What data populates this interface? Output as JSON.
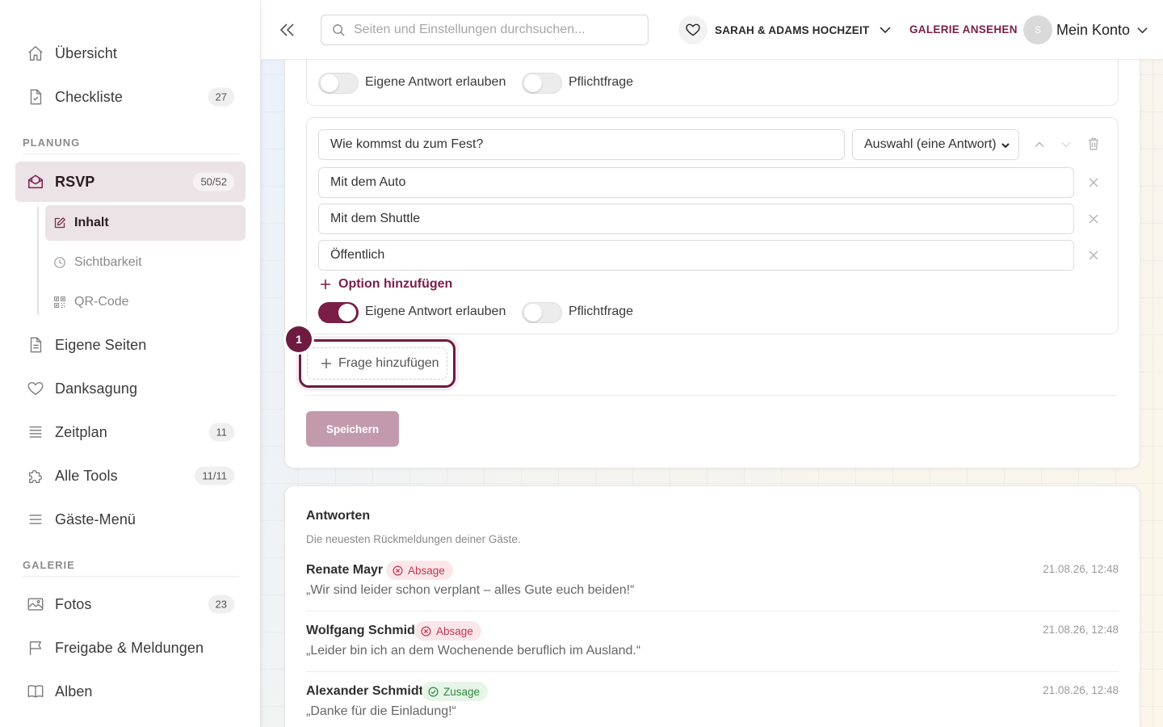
{
  "sidebar": {
    "items_top": [
      {
        "label": "Übersicht",
        "icon": "home-icon"
      },
      {
        "label": "Checkliste",
        "icon": "checklist-icon",
        "badge": "27"
      }
    ],
    "section_planning": "PLANUNG",
    "rsvp": {
      "label": "RSVP",
      "badge": "50/52",
      "icon": "envelope-icon"
    },
    "rsvp_sub": [
      {
        "label": "Inhalt",
        "icon": "edit-icon"
      },
      {
        "label": "Sichtbarkeit",
        "icon": "clock-icon"
      },
      {
        "label": "QR-Code",
        "icon": "qr-code-icon"
      }
    ],
    "items_planning": [
      {
        "label": "Eigene Seiten",
        "icon": "page-icon"
      },
      {
        "label": "Danksagung",
        "icon": "heart-icon"
      },
      {
        "label": "Zeitplan",
        "icon": "list-icon",
        "badge": "11"
      },
      {
        "label": "Alle Tools",
        "icon": "puzzle-icon",
        "badge": "11/11"
      },
      {
        "label": "Gäste-Menü",
        "icon": "menu-icon"
      }
    ],
    "section_gallery": "GALERIE",
    "items_gallery": [
      {
        "label": "Fotos",
        "icon": "image-icon",
        "badge": "23"
      },
      {
        "label": "Freigabe & Meldungen",
        "icon": "flag-icon"
      },
      {
        "label": "Alben",
        "icon": "book-icon"
      }
    ]
  },
  "topbar": {
    "search_placeholder": "Seiten und Einstellungen durchsuchen...",
    "event_name": "SARAH & ADAMS HOCHZEIT",
    "gallery_link": "GALERIE ANSEHEN",
    "account_initial": "S",
    "account_label": "Mein Konto"
  },
  "editor": {
    "prev_question_toggles": {
      "own_answer_label": "Eigene Antwort erlauben",
      "own_answer_on": false,
      "required_label": "Pflichtfrage",
      "required_on": false
    },
    "question": {
      "text": "Wie kommst du zum Fest?",
      "type": "Auswahl (eine Antwort)",
      "options": [
        "Mit dem Auto",
        "Mit dem Shuttle",
        "Öffentlich"
      ],
      "add_option_label": "Option hinzufügen",
      "own_answer_label": "Eigene Antwort erlauben",
      "own_answer_on": true,
      "required_label": "Pflichtfrage",
      "required_on": false
    },
    "add_question_label": "Frage hinzufügen",
    "step_number": "1",
    "save_label": "Speichern",
    "accent_color": "#7a1e48"
  },
  "responses": {
    "title": "Antworten",
    "subtitle": "Die neuesten Rückmeldungen deiner Gäste.",
    "items": [
      {
        "name": "Renate Mayr",
        "status": "Absage",
        "status_type": "negative",
        "time": "21.08.26, 12:48",
        "message": "„Wir sind leider schon verplant – alles Gute euch beiden!“"
      },
      {
        "name": "Wolfgang Schmid",
        "status": "Absage",
        "status_type": "negative",
        "time": "21.08.26, 12:48",
        "message": "„Leider bin ich an dem Wochenende beruflich im Ausland.“"
      },
      {
        "name": "Alexander Schmidt",
        "status": "Zusage",
        "status_type": "positive",
        "time": "21.08.26, 12:48",
        "message": "„Danke für die Einladung!“"
      }
    ]
  }
}
